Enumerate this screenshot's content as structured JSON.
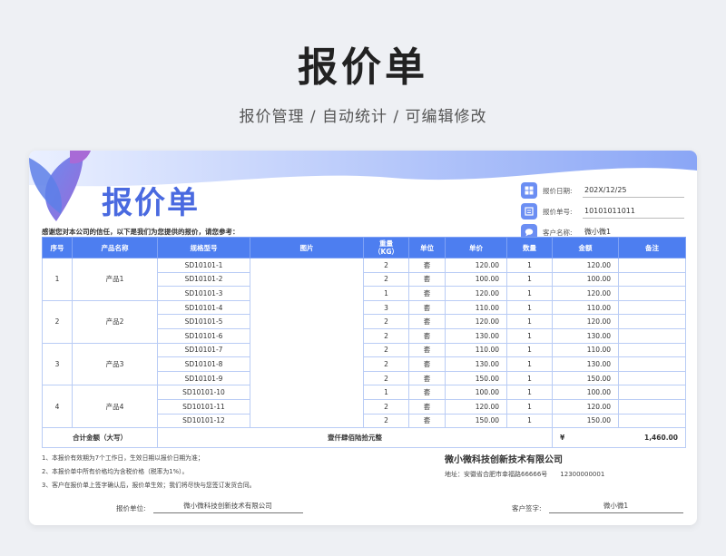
{
  "hero": {
    "title": "报价单",
    "subtitle": "报价管理 / 自动统计 / 可编辑修改"
  },
  "doc": {
    "title": "报价单",
    "thanks": "感谢您对本公司的信任，以下是我们为您提供的报价，请您参考：",
    "info": [
      {
        "label": "报价日期:",
        "value": "202X/12/25",
        "icon": "calendar-icon"
      },
      {
        "label": "报价单号:",
        "value": "10101011011",
        "icon": "document-icon"
      },
      {
        "label": "客户名称:",
        "value": "微小微1",
        "icon": "chat-bubble-icon"
      }
    ]
  },
  "table": {
    "headers": [
      "序号",
      "产品名称",
      "规格型号",
      "图片",
      "重量\n（KG）",
      "单位",
      "单价",
      "数量",
      "金额",
      "备注"
    ],
    "groups": [
      {
        "seq": "1",
        "product": "产品1",
        "rows": [
          {
            "spec": "SD10101-1",
            "weight": "2",
            "unit": "套",
            "price": "120.00",
            "qty": "1",
            "amount": "120.00"
          },
          {
            "spec": "SD10101-2",
            "weight": "2",
            "unit": "套",
            "price": "100.00",
            "qty": "1",
            "amount": "100.00"
          },
          {
            "spec": "SD10101-3",
            "weight": "1",
            "unit": "套",
            "price": "120.00",
            "qty": "1",
            "amount": "120.00"
          }
        ]
      },
      {
        "seq": "2",
        "product": "产品2",
        "rows": [
          {
            "spec": "SD10101-4",
            "weight": "3",
            "unit": "套",
            "price": "110.00",
            "qty": "1",
            "amount": "110.00"
          },
          {
            "spec": "SD10101-5",
            "weight": "2",
            "unit": "套",
            "price": "120.00",
            "qty": "1",
            "amount": "120.00"
          },
          {
            "spec": "SD10101-6",
            "weight": "2",
            "unit": "套",
            "price": "130.00",
            "qty": "1",
            "amount": "130.00"
          }
        ]
      },
      {
        "seq": "3",
        "product": "产品3",
        "rows": [
          {
            "spec": "SD10101-7",
            "weight": "2",
            "unit": "套",
            "price": "110.00",
            "qty": "1",
            "amount": "110.00"
          },
          {
            "spec": "SD10101-8",
            "weight": "2",
            "unit": "套",
            "price": "130.00",
            "qty": "1",
            "amount": "130.00"
          },
          {
            "spec": "SD10101-9",
            "weight": "2",
            "unit": "套",
            "price": "150.00",
            "qty": "1",
            "amount": "150.00"
          }
        ]
      },
      {
        "seq": "4",
        "product": "产品4",
        "rows": [
          {
            "spec": "SD10101-10",
            "weight": "1",
            "unit": "套",
            "price": "100.00",
            "qty": "1",
            "amount": "100.00"
          },
          {
            "spec": "SD10101-11",
            "weight": "2",
            "unit": "套",
            "price": "120.00",
            "qty": "1",
            "amount": "120.00"
          },
          {
            "spec": "SD10101-12",
            "weight": "2",
            "unit": "套",
            "price": "150.00",
            "qty": "1",
            "amount": "150.00"
          }
        ]
      }
    ],
    "total": {
      "label": "合计金额（大写）",
      "words": "壹仟肆佰陆拾元整",
      "currency": "¥",
      "amount": "1,460.00"
    }
  },
  "notes": [
    "1、本报价有效期为7个工作日，生效日期以报价日期为准；",
    "2、本报价单中所有价格均为含税价格（税率为1%）。",
    "3、客户在报价单上签字确认后，报价单生效；我们将尽快与您签订发货合同。"
  ],
  "company": {
    "name": "微小微科技创新技术有限公司",
    "address": "地址：安徽省合肥市幸福路66666号",
    "phone": "12300000001"
  },
  "signatures": {
    "quoter_label": "报价单位:",
    "quoter_value": "微小微科技创新技术有限公司",
    "customer_label": "客户签字:",
    "customer_value": "微小微1"
  },
  "colors": {
    "accent": "#4d7ef0",
    "title": "#4a6ae0",
    "deco_purple": "#8a5ed6"
  }
}
